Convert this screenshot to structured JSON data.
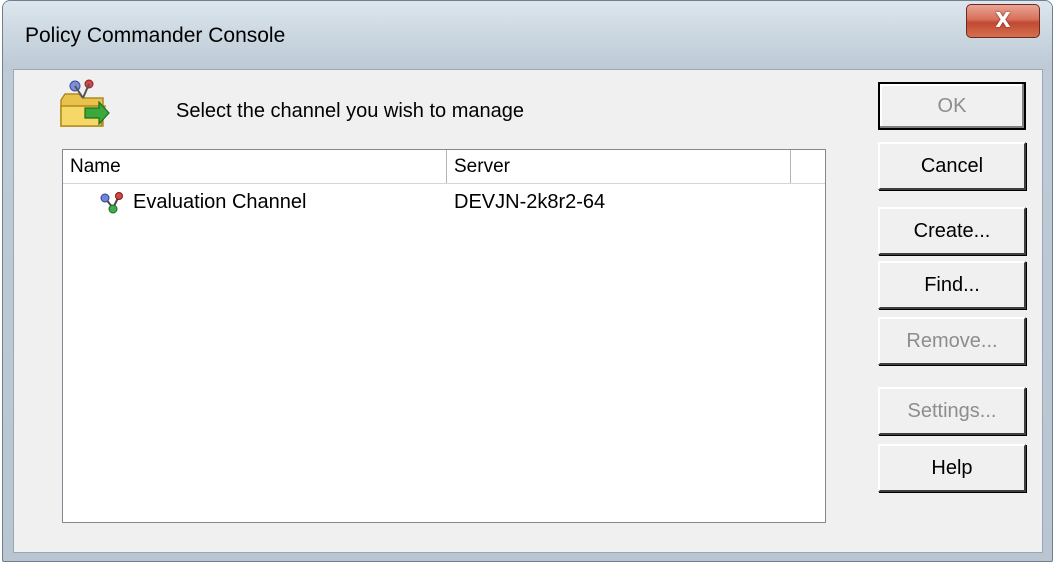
{
  "window": {
    "title": "Policy Commander Console",
    "close_label": "X"
  },
  "prompt": "Select the channel you wish to manage",
  "list": {
    "columns": [
      "Name",
      "Server"
    ],
    "rows": [
      {
        "name": "Evaluation Channel",
        "server": "DEVJN-2k8r2-64",
        "icon": "channel-icon"
      }
    ]
  },
  "buttons": {
    "ok": "OK",
    "cancel": "Cancel",
    "create": "Create...",
    "find": "Find...",
    "remove": "Remove...",
    "settings": "Settings...",
    "help": "Help"
  },
  "icons": {
    "header": "channel-folder-icon",
    "close": "close-icon"
  },
  "colors": {
    "close_button": "#c9553e",
    "disabled_text": "#8d8d8d",
    "dialog_bg": "#f0f0f0"
  }
}
